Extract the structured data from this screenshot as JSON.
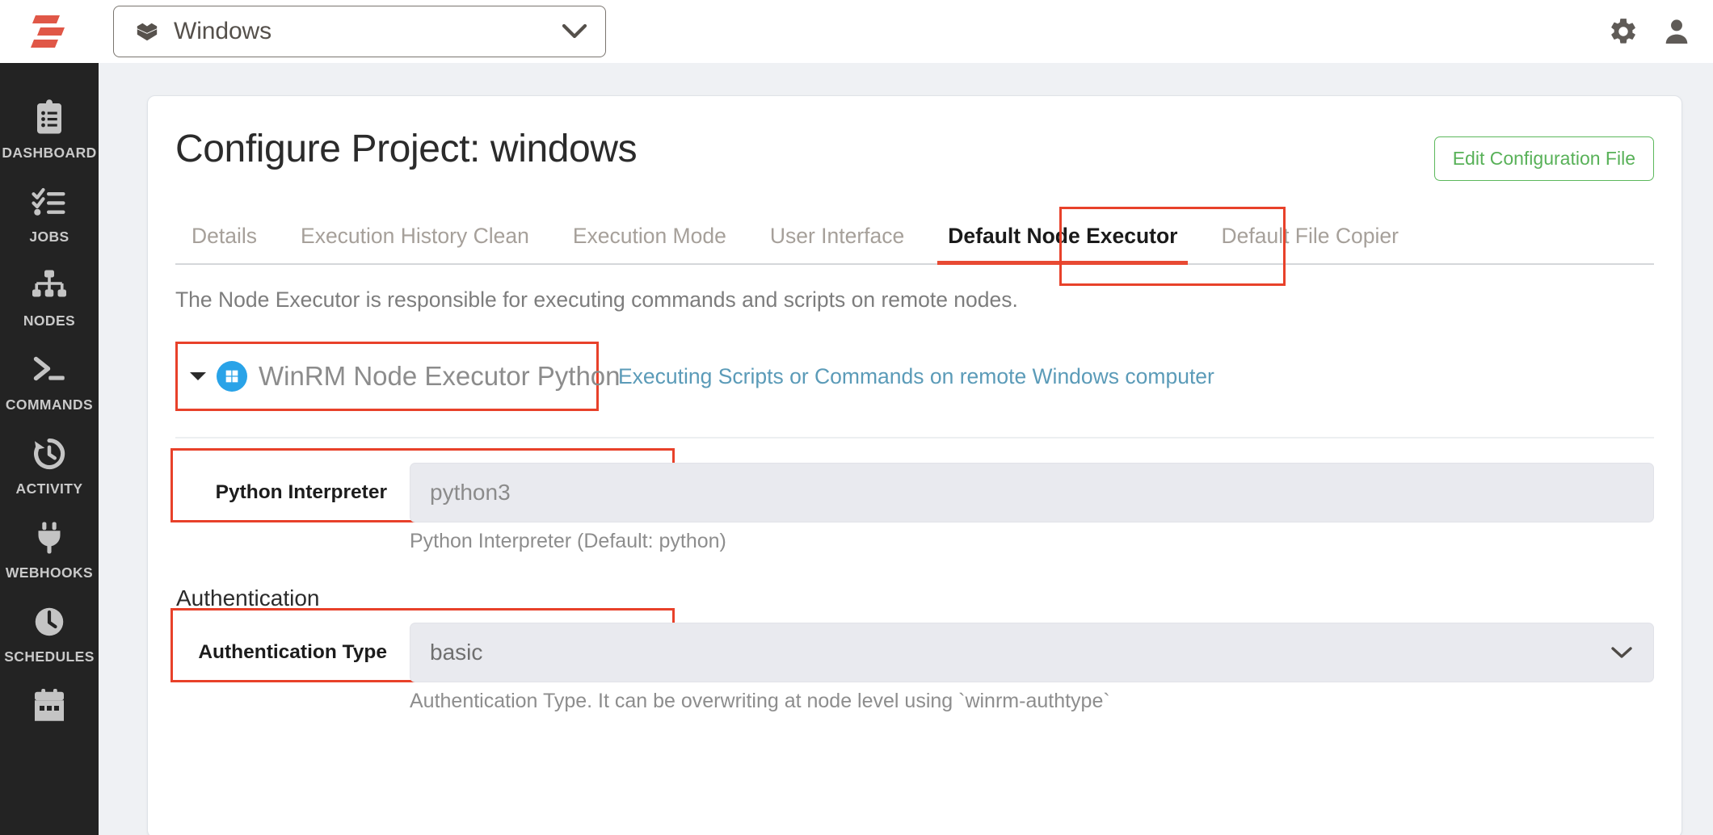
{
  "topbar": {
    "logo_name": "rundeck-logo",
    "project_selector": {
      "label": "Windows",
      "icon": "project-box-icon",
      "chevron": "chevron-down-icon"
    },
    "gear_icon": "gear-icon",
    "user_icon": "user-icon"
  },
  "sidebar": {
    "items": [
      {
        "label": "DASHBOARD",
        "icon": "clipboard-list-icon"
      },
      {
        "label": "JOBS",
        "icon": "checklist-icon"
      },
      {
        "label": "NODES",
        "icon": "sitemap-icon"
      },
      {
        "label": "COMMANDS",
        "icon": "terminal-prompt-icon"
      },
      {
        "label": "ACTIVITY",
        "icon": "history-clock-icon"
      },
      {
        "label": "WEBHOOKS",
        "icon": "plug-icon"
      },
      {
        "label": "SCHEDULES",
        "icon": "clock-icon"
      },
      {
        "label": "",
        "icon": "calendar-icon"
      }
    ]
  },
  "main": {
    "title": "Configure Project: windows",
    "edit_config_button": "Edit Configuration File",
    "tabs": [
      {
        "label": "Details",
        "active": false
      },
      {
        "label": "Execution History Clean",
        "active": false
      },
      {
        "label": "Execution Mode",
        "active": false
      },
      {
        "label": "User Interface",
        "active": false
      },
      {
        "label": "Default Node Executor",
        "active": true
      },
      {
        "label": "Default File Copier",
        "active": false
      }
    ],
    "executor_description": "The Node Executor is responsible for executing commands and scripts on remote nodes.",
    "plugin": {
      "name": "WinRM Node Executor Python",
      "icon": "windows-logo-icon",
      "caret": "caret-down-icon",
      "doc_link": "Executing Scripts or Commands on remote Windows computer"
    },
    "fields": [
      {
        "label": "Python Interpreter",
        "value": "python3",
        "placeholder": "python",
        "help": "Python Interpreter (Default: python)",
        "type": "text"
      }
    ],
    "authentication_section_title": "Authentication",
    "auth_field": {
      "label": "Authentication Type",
      "value": "basic",
      "help": "Authentication Type. It can be overwriting at node level using `winrm-authtype`",
      "type": "select",
      "chevron": "chevron-down-icon"
    }
  },
  "colors": {
    "brand_red": "#e8412a",
    "accent_green": "#5cb85c",
    "link_blue": "#5b9bb8",
    "windows_blue": "#29a3e8",
    "sidebar_bg": "#232323",
    "page_bg": "#eff1f4"
  }
}
